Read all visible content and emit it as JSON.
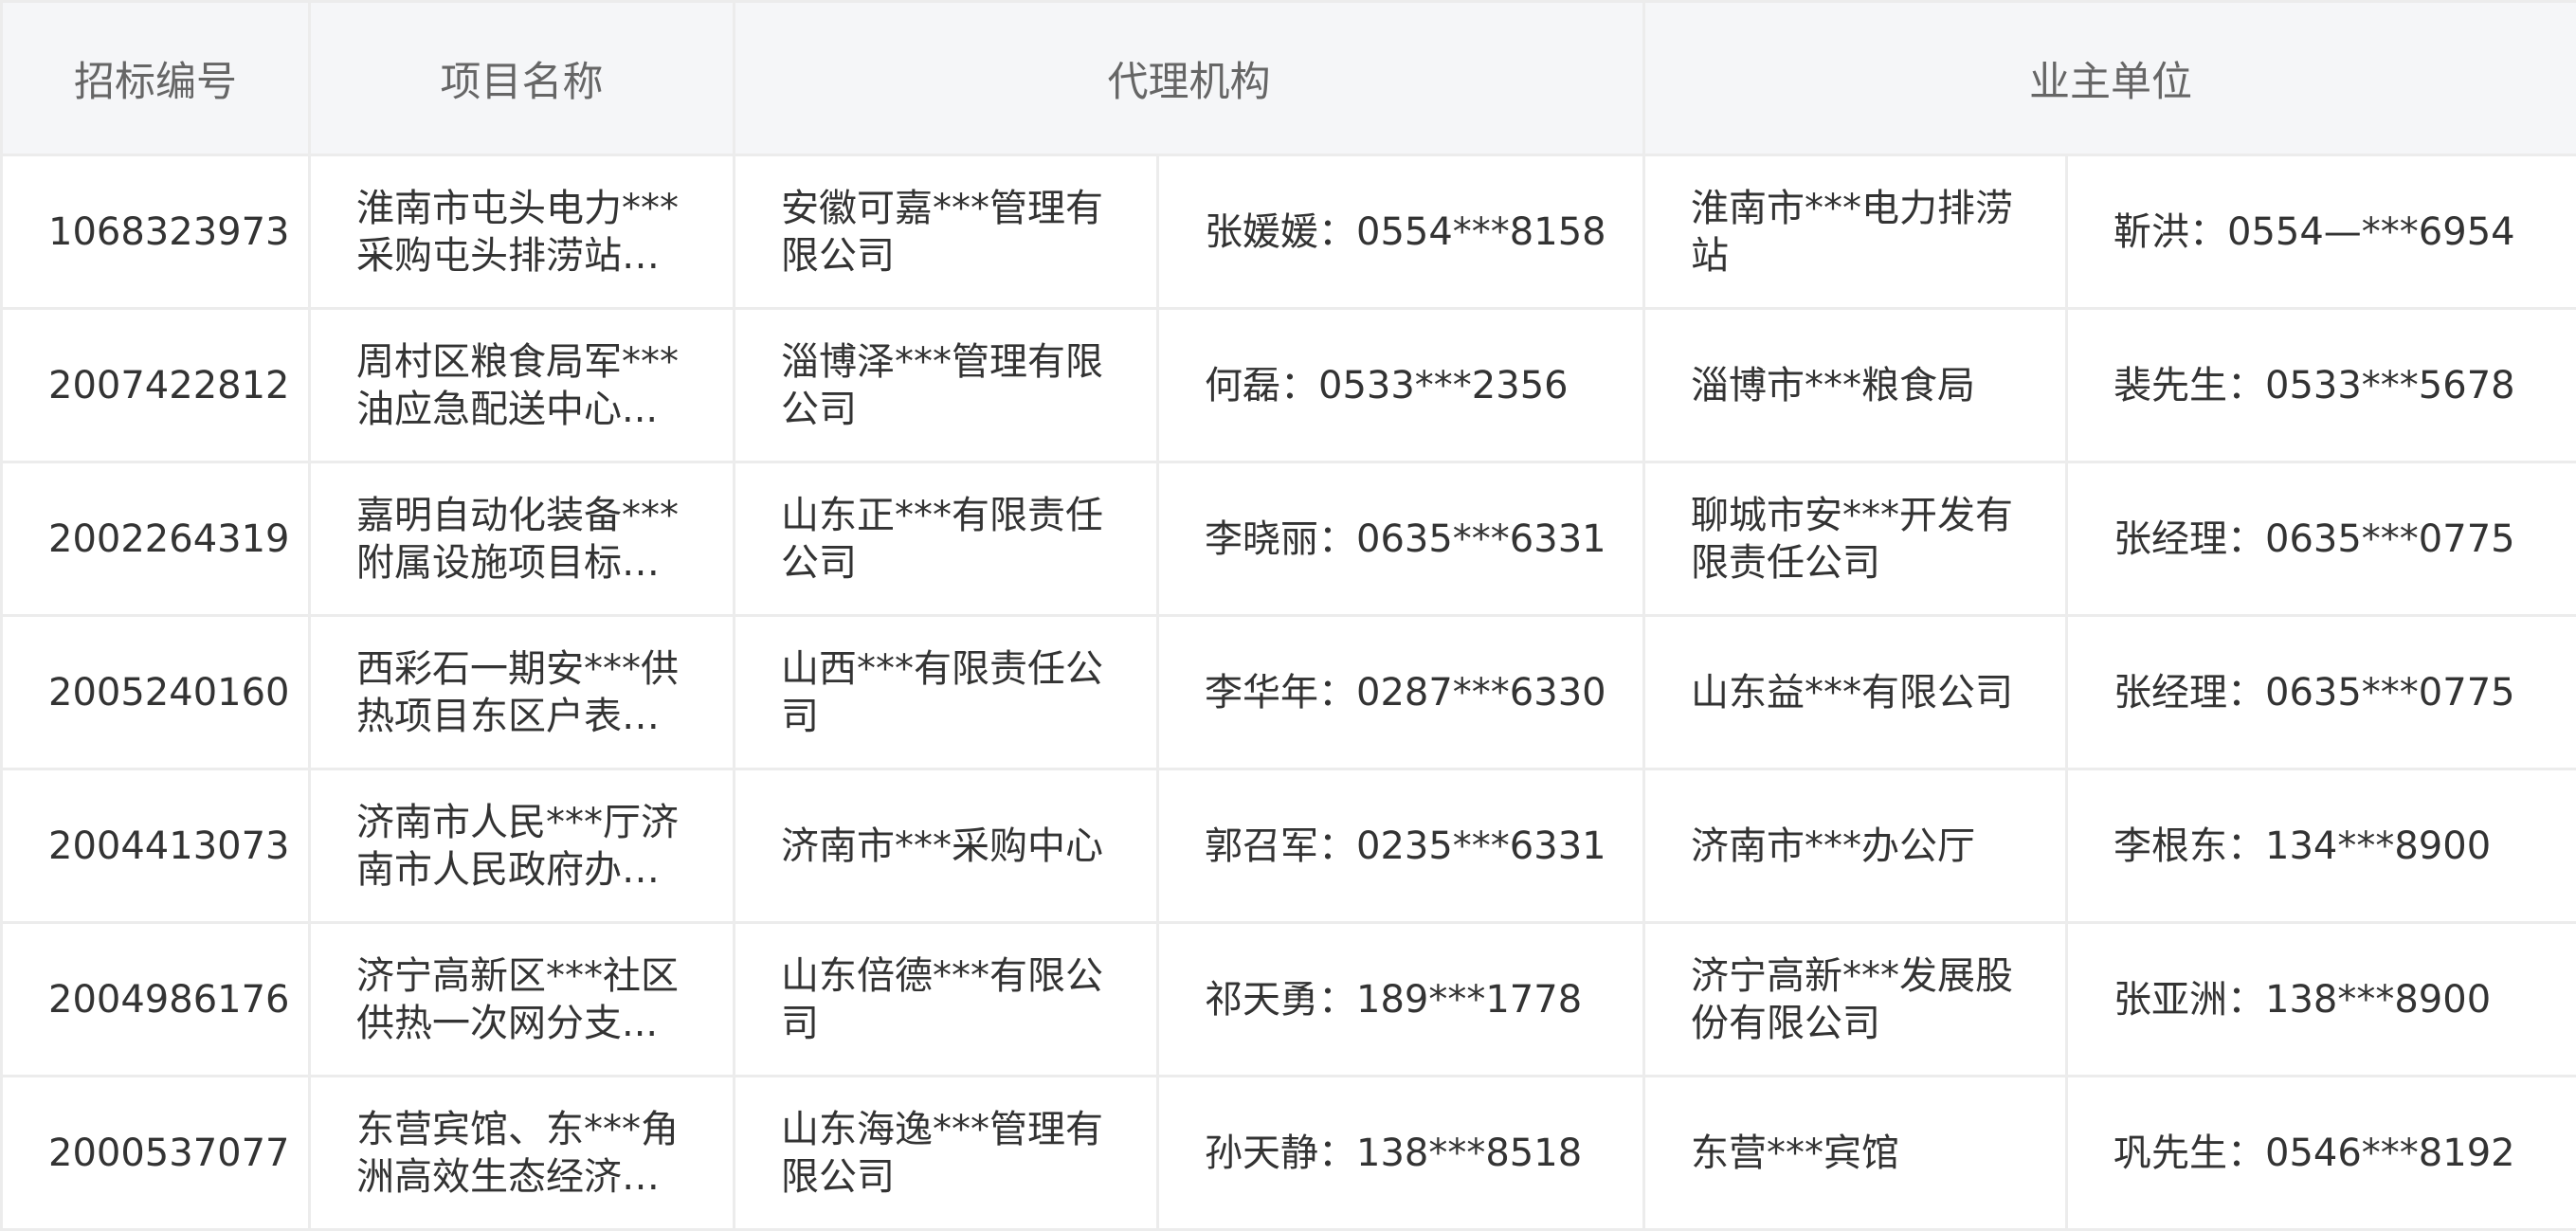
{
  "table": {
    "headers": {
      "bid_no": "招标编号",
      "project_name": "项目名称",
      "agent": "代理机构",
      "owner": "业主单位"
    },
    "rows": [
      {
        "bid_no": "1068323973",
        "project_name": "淮南市屯头电力***采购屯头排涝站更...",
        "agent": "安徽可嘉***管理有限公司",
        "agent_contact": "张媛媛：0554***8158",
        "owner": "淮南市***电力排涝站",
        "owner_contact": "靳洪：0554—***6954"
      },
      {
        "bid_no": "2007422812",
        "project_name": "周村区粮食局军***油应急配送中心...",
        "agent": "淄博泽***管理有限公司",
        "agent_contact": "何磊：0533***2356",
        "owner": "淄博市***粮食局",
        "owner_contact": "裴先生：0533***5678"
      },
      {
        "bid_no": "2002264319",
        "project_name": "嘉明自动化装备***附属设施项目标段...",
        "agent": "山东正***有限责任公司",
        "agent_contact": "李晓丽：0635***6331",
        "owner": "聊城市安***开发有限责任公司",
        "owner_contact": "张经理：0635***0775"
      },
      {
        "bid_no": "2005240160",
        "project_name": "西彩石一期安***供热项目东区户表安...",
        "agent": "山西***有限责任公司",
        "agent_contact": "李华年：0287***6330",
        "owner": "山东益***有限公司",
        "owner_contact": "张经理：0635***0775"
      },
      {
        "bid_no": "2004413073",
        "project_name": "济南市人民***厅济南市人民政府办公...",
        "agent": "济南市***采购中心",
        "agent_contact": "郭召军：0235***6331",
        "owner": "济南市***办公厅",
        "owner_contact": "李根东：134***8900"
      },
      {
        "bid_no": "2004986176",
        "project_name": "济宁高新区***社区供热一次网分支...",
        "agent": "山东倍德***有限公司",
        "agent_contact": "祁天勇：189***1778",
        "owner": "济宁高新***发展股份有限公司",
        "owner_contact": "张亚洲：138***8900"
      },
      {
        "bid_no": "2000537077",
        "project_name": "东营宾馆、东***角洲高效生态经济区...",
        "agent": "山东海逸***管理有限公司",
        "agent_contact": "孙天静：138***8518",
        "owner": "东营***宾馆",
        "owner_contact": "巩先生：0546***8192"
      }
    ]
  },
  "colors": {
    "header_bg": "#f5f6f8",
    "border": "#ececec",
    "header_text": "#666666",
    "body_text": "#333333"
  }
}
